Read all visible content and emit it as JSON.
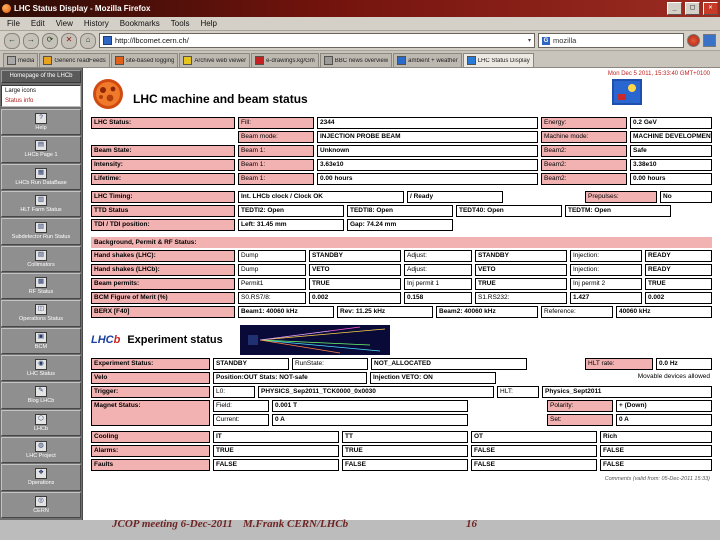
{
  "window": {
    "title": "LHC Status Display - Mozilla Firefox",
    "minimize": "_",
    "maximize": "□",
    "close": "✕"
  },
  "menu": [
    "File",
    "Edit",
    "View",
    "History",
    "Bookmarks",
    "Tools",
    "Help"
  ],
  "nav": {
    "back": "←",
    "forward": "→",
    "reload": "⟳",
    "stop": "✕",
    "home": "⌂",
    "url": "http://lbcomet.cern.ch/",
    "url_drop": "▾",
    "search_engine": "G",
    "search_value": "mozilla"
  },
  "tabs": [
    {
      "label": "media"
    },
    {
      "label": "Generic readFeeds"
    },
    {
      "label": "site-based logging"
    },
    {
      "label": "Archive web viewer"
    },
    {
      "label": "e-drawings.kg/Gm"
    },
    {
      "label": "BBC news overview"
    },
    {
      "label": "ambient + weather"
    },
    {
      "label": "LHC Status Display",
      "active": true
    }
  ],
  "sidebar": {
    "header": "Homepage of the LHCb",
    "listbox": [
      "Large icons",
      "Status info"
    ],
    "items": [
      {
        "icon": "?",
        "label": "Help"
      },
      {
        "icon": "▤",
        "label": "LHCb Page 1"
      },
      {
        "icon": "▦",
        "label": "LHCb Run DataBase"
      },
      {
        "icon": "▥",
        "label": "HLT Farm Status"
      },
      {
        "icon": "▧",
        "label": "Subdetector Run Status"
      },
      {
        "icon": "▨",
        "label": "Collimators"
      },
      {
        "icon": "▩",
        "label": "RF Status"
      },
      {
        "icon": "◫",
        "label": "Operations Status"
      },
      {
        "icon": "▣",
        "label": "BCM"
      },
      {
        "icon": "◉",
        "label": "LHC Status"
      },
      {
        "icon": "✎",
        "label": "Blog LHCb"
      },
      {
        "icon": "⬡",
        "label": "LHCb"
      },
      {
        "icon": "◍",
        "label": "LHC Project"
      },
      {
        "icon": "❖",
        "label": "Operations"
      },
      {
        "icon": "◎",
        "label": "CERN"
      }
    ]
  },
  "page": {
    "timestamp": "Mon Dec 5 2011, 15:33:40 GMT+0100",
    "title": "LHC machine and beam status",
    "status_rows": [
      [
        "LHC Status:",
        "Fill:",
        "2344",
        "Energy:",
        "0.2 GeV"
      ],
      [
        "",
        "Beam mode:",
        "INJECTION PROBE BEAM",
        "Machine mode:",
        "MACHINE DEVELOPMENT"
      ],
      [
        "Beam State:",
        "Beam 1:",
        "Unknown",
        "Beam2:",
        "Safe"
      ],
      [
        "Intensity:",
        "Beam 1:",
        "3.63e10",
        "Beam2:",
        "3.38e10"
      ],
      [
        "Lifetime:",
        "Beam 1:",
        "0.00 hours",
        "Beam2:",
        "0.00 hours"
      ]
    ],
    "timing": {
      "label": "LHC Timing:",
      "clock": "Int. LHCb clock / Clock OK",
      "ready": "/ Ready",
      "prepulses_label": "Prepulses:",
      "prepulses_value": "No"
    },
    "ttd": {
      "label": "TTD Status",
      "t1": "TEDTI2:  Open",
      "t2": "TEDTI8:  Open",
      "t3": "TEDT40:  Open",
      "t4": "TEDTM:  Open"
    },
    "tdi": {
      "label": "TDI / TDI position:",
      "left": "Left: 31.45 mm",
      "gap": "Gap: 74.24 mm"
    },
    "bg_header": "Background, Permit & RF Status:",
    "handshake_rows": [
      [
        "Hand shakes (LHC):",
        "Dump",
        "STANDBY",
        "Adjust:",
        "STANDBY",
        "Injection:",
        "READY"
      ],
      [
        "Hand shakes (LHCb):",
        "Dump",
        "VETO",
        "Adjust:",
        "VETO",
        "Injection:",
        "READY"
      ],
      [
        "Beam permits:",
        "Permit1",
        "TRUE",
        "Inj permit 1",
        "TRUE",
        "Inj permit 2",
        "TRUE"
      ]
    ],
    "bcm": {
      "label": "BCM Figure of Merit (%)",
      "k1": "S0.RS7/8:",
      "v1": "0.002",
      "v2": "0.158",
      "k2": "S1.RS232:",
      "v3": "1.427",
      "v4": "0.002"
    },
    "bprx": {
      "label": "BERX [F40]",
      "v1": "Beam1: 40060 kHz",
      "v2": "Rev: 11.25 kHz",
      "v3": "Beam2: 40060 kHz",
      "k1": "Reference:",
      "v4": "40060 kHz"
    },
    "experiment": {
      "logo1": "LHC",
      "logo2": "b",
      "title": "Experiment status",
      "status": {
        "label": "Experiment Status:",
        "v1": "STANDBY",
        "k1": "RunState:",
        "v2": "NOT_ALLOCATED",
        "k2": "HLT rate:",
        "v3": "0.0 Hz"
      },
      "velo": {
        "label": "Velo",
        "v1": "Position:OUT  Stats: NOT-safe",
        "v2": "Injection VETO: ON",
        "note": "Movable devices allowed"
      },
      "trigger": {
        "label": "Trigger:",
        "k1": "L0:",
        "v1": "PHYSICS_Sep2011_TCK0000_0x0030",
        "k2": "HLT:",
        "v2": "Physics_Sept2011"
      },
      "magnet": {
        "label": "Magnet Status:",
        "k1": "Field:",
        "v1": "0.001 T",
        "k2": "Polarity:",
        "v2": "+ (Down)",
        "k3": "Current:",
        "v3": "0 A",
        "k4": "Set:",
        "v4": "0 A"
      },
      "cooling": {
        "label": "Cooling",
        "h": [
          "IT",
          "TT",
          "OT",
          "Rich"
        ],
        "alarms_label": "Alarms:",
        "alarms": [
          "TRUE",
          "TRUE",
          "FALSE",
          "FALSE"
        ],
        "faults_label": "Faults",
        "faults": [
          "FALSE",
          "FALSE",
          "FALSE",
          "FALSE"
        ]
      },
      "comments": "Comments (valid from: 05-Dec-2011 15:33)"
    }
  },
  "footer": {
    "left": "JCOP meeting 6-Dec-2011",
    "center": "M.Frank CERN/LHCb",
    "page": "16"
  }
}
